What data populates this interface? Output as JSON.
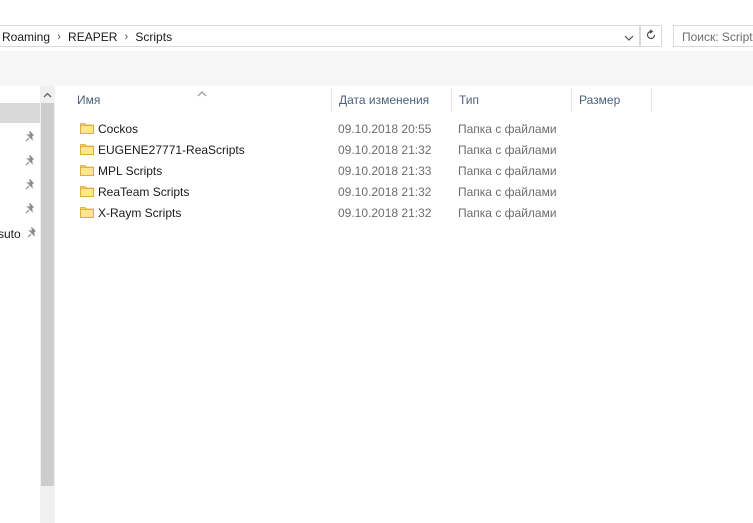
{
  "address_bar": {
    "breadcrumbs": [
      "Roaming",
      "REAPER",
      "Scripts"
    ]
  },
  "search": {
    "placeholder": "Поиск: Scripts"
  },
  "navigation_pane": {
    "items": [
      {
        "label": "",
        "pinned": true
      },
      {
        "label": "",
        "pinned": true
      },
      {
        "label": "",
        "pinned": true
      },
      {
        "label": "",
        "pinned": true
      },
      {
        "label": "suto",
        "pinned": true
      }
    ]
  },
  "file_list": {
    "columns": {
      "name": "Имя",
      "date": "Дата изменения",
      "type": "Тип",
      "size": "Размер"
    },
    "sorted_by": "name",
    "rows": [
      {
        "name": "Cockos",
        "date": "09.10.2018 20:55",
        "type": "Папка с файлами",
        "size": ""
      },
      {
        "name": "EUGENE27771-ReaScripts",
        "date": "09.10.2018 21:32",
        "type": "Папка с файлами",
        "size": ""
      },
      {
        "name": "MPL Scripts",
        "date": "09.10.2018 21:33",
        "type": "Папка с файлами",
        "size": ""
      },
      {
        "name": "ReaTeam Scripts",
        "date": "09.10.2018 21:32",
        "type": "Папка с файлами",
        "size": ""
      },
      {
        "name": "X-Raym Scripts",
        "date": "09.10.2018 21:32",
        "type": "Папка с файлами",
        "size": ""
      }
    ]
  },
  "colors": {
    "folder": "#f6d36b",
    "header_text": "#4c607a",
    "meta_text": "#6d6d6d",
    "scroll_thumb": "#cdcdcd"
  }
}
